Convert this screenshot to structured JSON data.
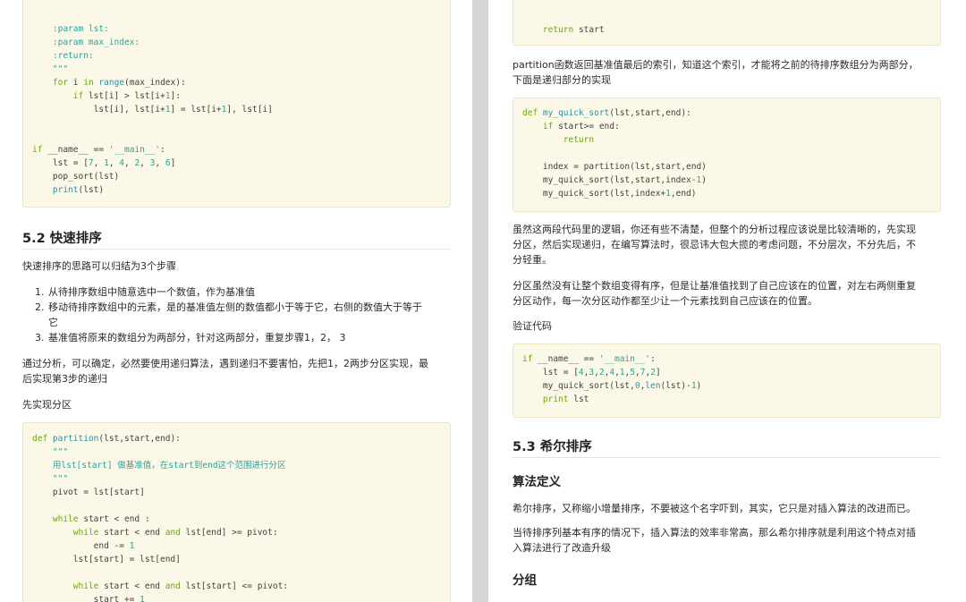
{
  "left": {
    "code1": {
      "lines": [
        [
          [
            "pl",
            "    "
          ],
          [
            "cm",
            ":param lst:"
          ]
        ],
        [
          [
            "pl",
            "    "
          ],
          [
            "cm",
            ":param max_index:"
          ]
        ],
        [
          [
            "pl",
            "    "
          ],
          [
            "cm",
            ":return:"
          ]
        ],
        [
          [
            "pl",
            "    "
          ],
          [
            "cm",
            "\"\"\""
          ]
        ],
        [
          [
            "pl",
            "    "
          ],
          [
            "kw",
            "for"
          ],
          [
            "pl",
            " i "
          ],
          [
            "kw",
            "in"
          ],
          [
            "pl",
            " "
          ],
          [
            "fn",
            "range"
          ],
          [
            "pl",
            "(max_index):"
          ]
        ],
        [
          [
            "pl",
            "        "
          ],
          [
            "kw",
            "if"
          ],
          [
            "pl",
            " lst[i] > lst[i+"
          ],
          [
            "num",
            "1"
          ],
          [
            "pl",
            "]:"
          ]
        ],
        [
          [
            "pl",
            "            lst[i], lst[i+"
          ],
          [
            "num",
            "1"
          ],
          [
            "pl",
            "] = lst[i+"
          ],
          [
            "num",
            "1"
          ],
          [
            "pl",
            "], lst[i]"
          ]
        ],
        [],
        [],
        [
          [
            "kw",
            "if"
          ],
          [
            "pl",
            " __name__ == "
          ],
          [
            "str",
            "'__main__'"
          ],
          [
            "pl",
            ":"
          ]
        ],
        [
          [
            "pl",
            "    lst = ["
          ],
          [
            "num",
            "7"
          ],
          [
            "pl",
            ", "
          ],
          [
            "num",
            "1"
          ],
          [
            "pl",
            ", "
          ],
          [
            "num",
            "4"
          ],
          [
            "pl",
            ", "
          ],
          [
            "num",
            "2"
          ],
          [
            "pl",
            ", "
          ],
          [
            "num",
            "3"
          ],
          [
            "pl",
            ", "
          ],
          [
            "num",
            "6"
          ],
          [
            "pl",
            "]"
          ]
        ],
        [
          [
            "pl",
            "    pop_sort(lst)"
          ]
        ],
        [
          [
            "pl",
            "    "
          ],
          [
            "fn",
            "print"
          ],
          [
            "pl",
            "(lst)"
          ]
        ]
      ]
    },
    "heading": "5.2 快速排序",
    "intro": "快速排序的思路可以归结为3个步骤",
    "steps": [
      {
        "num": "1.",
        "lines": [
          "从待排序数组中随意选中一个数值，作为基准值"
        ]
      },
      {
        "num": "2.",
        "lines": [
          "移动待排序数组中的元素，是的基准值左侧的数值都小于等于它，右侧的数值大于等于",
          "它"
        ]
      },
      {
        "num": "3.",
        "lines": [
          "基准值将原来的数组分为两部分，针对这两部分，重复步骤1，2， 3"
        ]
      }
    ],
    "analysis": [
      "通过分析，可以确定，必然要使用递归算法，遇到递归不要害怕，先把1，2两步分区实现，最",
      "后实现第3步的递归"
    ],
    "first": "先实现分区",
    "code2": {
      "lines": [
        [
          [
            "kw",
            "def"
          ],
          [
            "pl",
            " "
          ],
          [
            "fn",
            "partition"
          ],
          [
            "pl",
            "(lst,start,end):"
          ]
        ],
        [
          [
            "pl",
            "    "
          ],
          [
            "cm",
            "\"\"\""
          ]
        ],
        [
          [
            "pl",
            "    "
          ],
          [
            "cm",
            "用lst[start] 做基准值，在start到end这个范围进行分区"
          ]
        ],
        [
          [
            "pl",
            "    "
          ],
          [
            "cm",
            "\"\"\""
          ]
        ],
        [
          [
            "pl",
            "    pivot = lst[start]"
          ]
        ],
        [],
        [
          [
            "pl",
            "    "
          ],
          [
            "kw",
            "while"
          ],
          [
            "pl",
            " start < end :"
          ]
        ],
        [
          [
            "pl",
            "        "
          ],
          [
            "kw",
            "while"
          ],
          [
            "pl",
            " start < end "
          ],
          [
            "kw",
            "and"
          ],
          [
            "pl",
            " lst[end] >= pivot:"
          ]
        ],
        [
          [
            "pl",
            "            end -= "
          ],
          [
            "num",
            "1"
          ]
        ],
        [
          [
            "pl",
            "        lst[start] = lst[end]"
          ]
        ],
        [],
        [
          [
            "pl",
            "        "
          ],
          [
            "kw",
            "while"
          ],
          [
            "pl",
            " start < end "
          ],
          [
            "kw",
            "and"
          ],
          [
            "pl",
            " lst[start] <= pivot:"
          ]
        ],
        [
          [
            "pl",
            "            start += "
          ],
          [
            "num",
            "1"
          ]
        ]
      ]
    }
  },
  "right": {
    "code1": {
      "lines": [
        [
          [
            "pl",
            "    "
          ],
          [
            "kw",
            "return"
          ],
          [
            "pl",
            " start"
          ]
        ]
      ]
    },
    "para1": [
      "partition函数返回基准值最后的索引，知道这个索引，才能将之前的待排序数组分为两部分，",
      "下面是递归部分的实现"
    ],
    "code2": {
      "lines": [
        [
          [
            "kw",
            "def"
          ],
          [
            "pl",
            " "
          ],
          [
            "fn",
            "my_quick_sort"
          ],
          [
            "pl",
            "(lst,start,end):"
          ]
        ],
        [
          [
            "pl",
            "    "
          ],
          [
            "kw",
            "if"
          ],
          [
            "pl",
            " start>= end:"
          ]
        ],
        [
          [
            "pl",
            "        "
          ],
          [
            "kw",
            "return"
          ]
        ],
        [],
        [
          [
            "pl",
            "    index = partition(lst,start,end)"
          ]
        ],
        [
          [
            "pl",
            "    my_quick_sort(lst,start,index-"
          ],
          [
            "num",
            "1"
          ],
          [
            "pl",
            ")"
          ]
        ],
        [
          [
            "pl",
            "    my_quick_sort(lst,index+"
          ],
          [
            "num",
            "1"
          ],
          [
            "pl",
            ",end)"
          ]
        ]
      ]
    },
    "para2": [
      "虽然这两段代码里的逻辑，你还有些不清楚，但整个的分析过程应该说是比较清晰的，先实现",
      "分区，然后实现递归，在编写算法时，很忌讳大包大揽的考虑问题，不分层次，不分先后，不",
      "分轻重。"
    ],
    "para3": [
      "分区虽然没有让整个数组变得有序，但是让基准值找到了自己应该在的位置，对左右两侧重复",
      "分区动作，每一次分区动作都至少让一个元素找到自己应该在的位置。"
    ],
    "verify": "验证代码",
    "code3": {
      "lines": [
        [
          [
            "kw",
            "if"
          ],
          [
            "pl",
            " __name__ == "
          ],
          [
            "str",
            "'__main__'"
          ],
          [
            "pl",
            ":"
          ]
        ],
        [
          [
            "pl",
            "    lst = ["
          ],
          [
            "num",
            "4"
          ],
          [
            "pl",
            ","
          ],
          [
            "num",
            "3"
          ],
          [
            "pl",
            ","
          ],
          [
            "num",
            "2"
          ],
          [
            "pl",
            ","
          ],
          [
            "num",
            "4"
          ],
          [
            "pl",
            ","
          ],
          [
            "num",
            "1"
          ],
          [
            "pl",
            ","
          ],
          [
            "num",
            "5"
          ],
          [
            "pl",
            ","
          ],
          [
            "num",
            "7"
          ],
          [
            "pl",
            ","
          ],
          [
            "num",
            "2"
          ],
          [
            "pl",
            "]"
          ]
        ],
        [
          [
            "pl",
            "    my_quick_sort(lst,"
          ],
          [
            "num",
            "0"
          ],
          [
            "pl",
            ","
          ],
          [
            "fn",
            "len"
          ],
          [
            "pl",
            "(lst)-"
          ],
          [
            "num",
            "1"
          ],
          [
            "pl",
            ")"
          ]
        ],
        [
          [
            "pl",
            "    "
          ],
          [
            "kw",
            "print"
          ],
          [
            "pl",
            " lst"
          ]
        ]
      ]
    },
    "heading": "5.3 希尔排序",
    "sub1": "算法定义",
    "para4": "希尔排序，又称缩小增量排序，不要被这个名字吓到，其实，它只是对插入算法的改进而已。",
    "para5": [
      "当待排序列基本有序的情况下，插入算法的效率非常高，那么希尔排序就是利用这个特点对插",
      "入算法进行了改造升级"
    ],
    "sub2": "分组"
  }
}
